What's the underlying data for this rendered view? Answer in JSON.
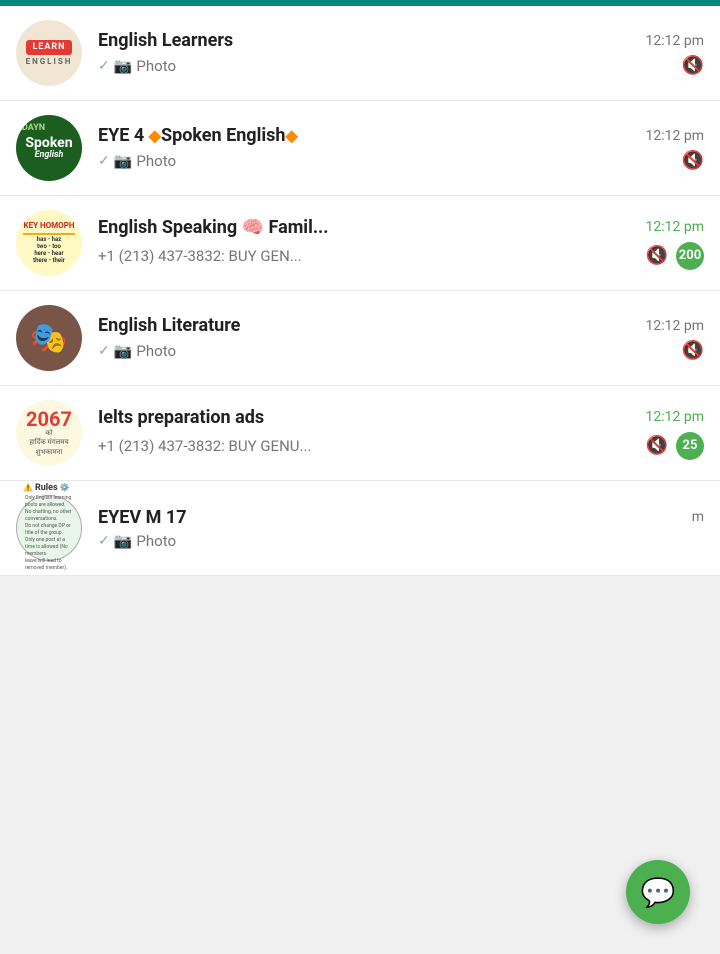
{
  "topbar": {
    "color": "#00897B"
  },
  "chats": [
    {
      "id": "english-learners",
      "name": "English Learners",
      "time": "12:12 pm",
      "time_green": false,
      "message_type": "photo",
      "message_text": "Photo",
      "has_check": true,
      "is_muted": true,
      "badge": null,
      "avatar_type": "el"
    },
    {
      "id": "eye4-spoken",
      "name": "EYE 4 🔷Spoken English🔷",
      "name_plain": "EYE 4 Spoken English",
      "time": "12:12 pm",
      "time_green": false,
      "message_type": "photo",
      "message_text": "Photo",
      "has_check": true,
      "is_muted": true,
      "badge": null,
      "avatar_type": "spoken"
    },
    {
      "id": "english-speaking",
      "name": "English Speaking 🧠 Famil...",
      "time": "12:12 pm",
      "time_green": true,
      "message_type": "text",
      "message_text": "+1 (213) 437-3832: BUY GEN...",
      "has_check": false,
      "is_muted": true,
      "badge": "200",
      "avatar_type": "speaking"
    },
    {
      "id": "english-literature",
      "name": "English Literature",
      "time": "12:12 pm",
      "time_green": false,
      "message_type": "photo",
      "message_text": "Photo",
      "has_check": true,
      "is_muted": true,
      "badge": null,
      "avatar_type": "literature"
    },
    {
      "id": "ielts-prep",
      "name": "Ielts preparation ads",
      "time": "12:12 pm",
      "time_green": true,
      "message_type": "text",
      "message_text": "+1 (213) 437-3832: BUY GENU...",
      "has_check": false,
      "is_muted": true,
      "badge": "25",
      "avatar_type": "ielts"
    },
    {
      "id": "eyev-m17",
      "name": "EYEV M 17",
      "time": "",
      "time_green": false,
      "message_type": "photo",
      "message_text": "Photo",
      "has_check": true,
      "is_muted": false,
      "badge": null,
      "avatar_type": "eyev"
    }
  ],
  "fab": {
    "icon": "💬",
    "label": "New chat"
  }
}
